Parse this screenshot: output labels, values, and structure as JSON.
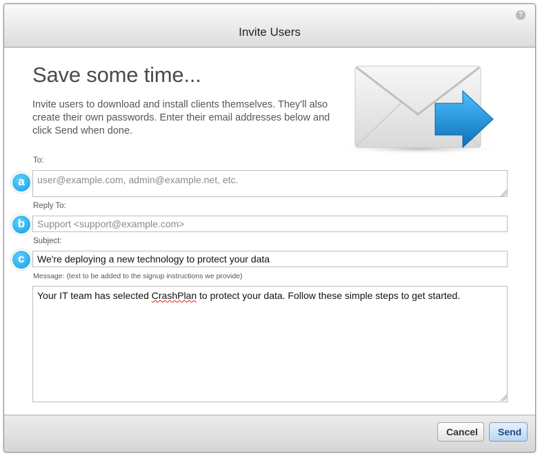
{
  "dialog": {
    "title": "Invite Users",
    "help_icon": "question-mark-icon",
    "help_glyph": "?"
  },
  "intro": {
    "headline": "Save some time...",
    "text": "Invite users to download and install clients themselves. They'll also create their own passwords. Enter their email addresses below and click Send when done.",
    "illustration": "envelope-arrow-icon"
  },
  "form": {
    "to": {
      "badge": "a",
      "label": "To:",
      "value": "",
      "placeholder": "user@example.com, admin@example.net, etc."
    },
    "reply_to": {
      "badge": "b",
      "label": "Reply To:",
      "value": "",
      "placeholder": "Support <support@example.com>"
    },
    "subject": {
      "badge": "c",
      "label": "Subject:",
      "value": "We're deploying a new technology to protect your data",
      "placeholder": ""
    },
    "message": {
      "label": "Message: (text to be added to the signup instructions we provide)",
      "text_before": "Your IT team has selected ",
      "misspelled_word": "CrashPlan",
      "text_after": " to protect your data. Follow these simple steps to get started."
    }
  },
  "footer": {
    "cancel_label": "Cancel",
    "send_label": "Send"
  },
  "colors": {
    "badge": "#1aa3e6",
    "send_text": "#1c4f86",
    "envelope_arrow": "#1a8fd6"
  }
}
